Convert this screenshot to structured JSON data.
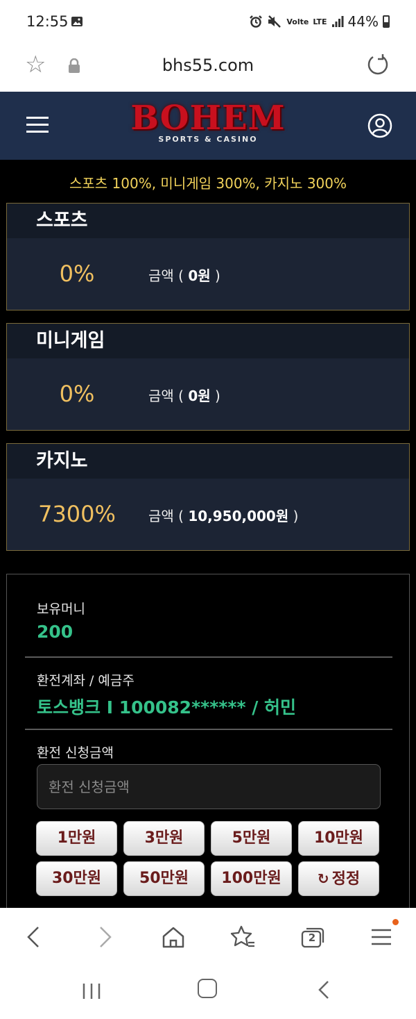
{
  "status": {
    "time": "12:55",
    "network_small": "Volte",
    "network_lte": "LTE",
    "battery": "44%"
  },
  "browser": {
    "url": "bhs55.com",
    "tab_count": "2"
  },
  "site": {
    "brand": "BOHEM",
    "tagline": "SPORTS & CASINO"
  },
  "promo": "스포츠 100%, 미니게임 300%, 카지노 300%",
  "cards": [
    {
      "title": "스포츠",
      "percent": "0%",
      "amount_label": "금액 (",
      "amount_value": "0원",
      "amount_close": ")"
    },
    {
      "title": "미니게임",
      "percent": "0%",
      "amount_label": "금액 (",
      "amount_value": "0원",
      "amount_close": ")"
    },
    {
      "title": "카지노",
      "percent": "7300%",
      "amount_label": "금액 (",
      "amount_value": "10,950,000원",
      "amount_close": ")"
    }
  ],
  "wallet": {
    "money_label": "보유머니",
    "money_value": "200",
    "account_label": "환전계좌 / 예금주",
    "account_value": "토스뱅크 I 100082****** / 허민",
    "request_label": "환전 신청금액",
    "request_placeholder": "환전 신청금액"
  },
  "amount_buttons": [
    "1만원",
    "3만원",
    "5만원",
    "10만원",
    "30만원",
    "50만원",
    "100만원"
  ],
  "reset_button": {
    "icon": "refresh-icon",
    "label": "정정"
  },
  "colors": {
    "header_bg": "#1f2f4c",
    "brand_red": "#c8101e",
    "promo_yellow": "#f2d35b",
    "percent_gold": "#f0c060",
    "value_green": "#35c28a",
    "chip_text": "#6a1c1c"
  }
}
